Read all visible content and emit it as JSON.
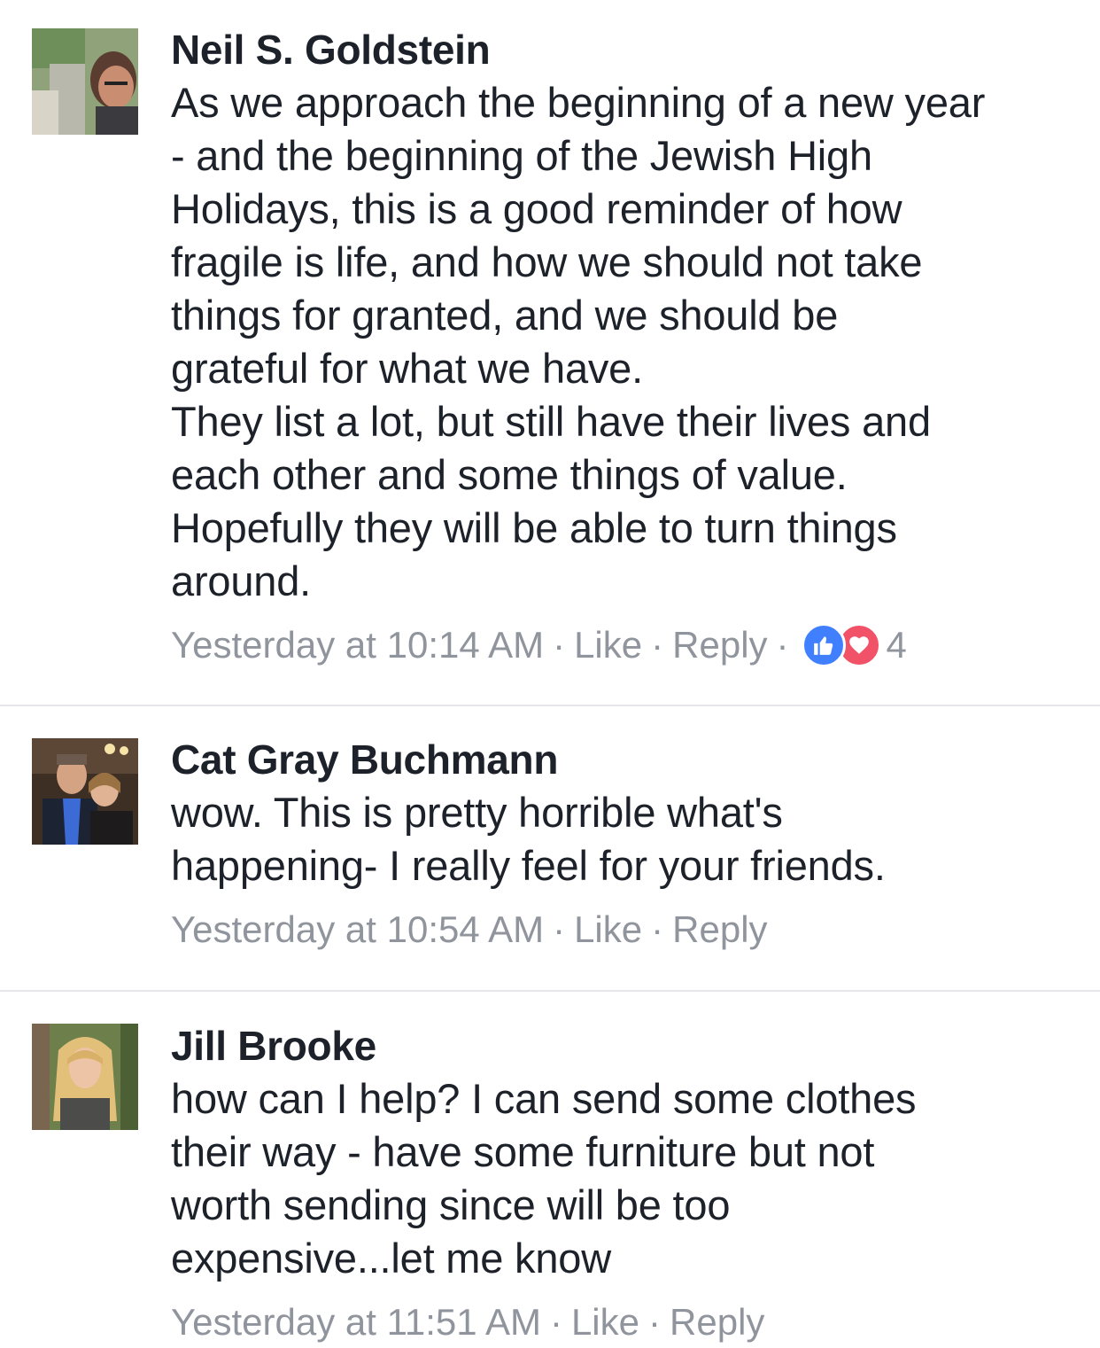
{
  "comments": [
    {
      "author": "Neil S. Goldstein",
      "lines": [
        "As we approach the beginning of a new year",
        "- and the beginning of the Jewish High",
        "Holidays, this is a good reminder of how",
        "fragile is life, and how we should not take",
        "things for granted, and we should be",
        "grateful for what we have.",
        "They list a lot, but still have their lives and",
        "each other and some things of value.",
        "Hopefully they will be able to turn things",
        "around."
      ],
      "timestamp": "Yesterday at 10:14 AM",
      "like_label": "Like",
      "reply_label": "Reply",
      "separator": "·",
      "reaction_count": "4",
      "reaction_icons": [
        "thumbs-up-icon",
        "heart-icon"
      ],
      "colors": {
        "like": "#4080ff",
        "love": "#f25268"
      }
    },
    {
      "author": "Cat Gray Buchmann",
      "lines": [
        "wow. This is pretty horrible what's",
        "happening- I really feel for your friends."
      ],
      "timestamp": "Yesterday at 10:54 AM",
      "like_label": "Like",
      "reply_label": "Reply",
      "separator": "·"
    },
    {
      "author": "Jill Brooke",
      "lines": [
        "how can I help? I can send some clothes",
        "their way - have some furniture but not",
        "worth sending since will be too",
        "expensive...let me know"
      ],
      "timestamp": "Yesterday at 11:51 AM",
      "like_label": "Like",
      "reply_label": "Reply",
      "separator": "·"
    }
  ],
  "colors": {
    "text": "#1d2129",
    "meta": "#90949c",
    "divider": "#e5e6e9"
  }
}
